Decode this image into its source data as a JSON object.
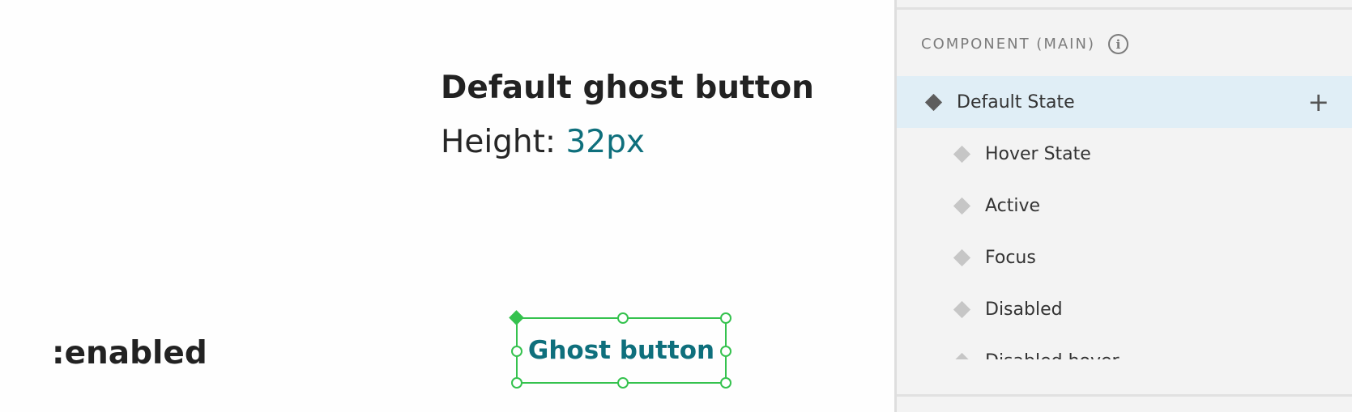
{
  "canvas": {
    "spec_title": "Default ghost button",
    "height_label": "Height:",
    "height_value": "32px",
    "state_label": ":enabled",
    "ghost_button_label": "Ghost button"
  },
  "panel": {
    "header": "COMPONENT (MAIN)",
    "info_icon": "i",
    "add_icon": "+",
    "states": [
      {
        "label": "Default State",
        "selected": true
      },
      {
        "label": "Hover State",
        "selected": false
      },
      {
        "label": "Active",
        "selected": false
      },
      {
        "label": "Focus",
        "selected": false
      },
      {
        "label": "Disabled",
        "selected": false
      },
      {
        "label": "Disabled hover",
        "selected": false
      }
    ]
  },
  "colors": {
    "accent_teal": "#0e6f7c",
    "selection_green": "#35c24e",
    "selected_row": "#e0eef6"
  },
  "icons": {
    "info": "info-icon",
    "add": "plus-icon",
    "state_marker": "diamond-icon"
  }
}
